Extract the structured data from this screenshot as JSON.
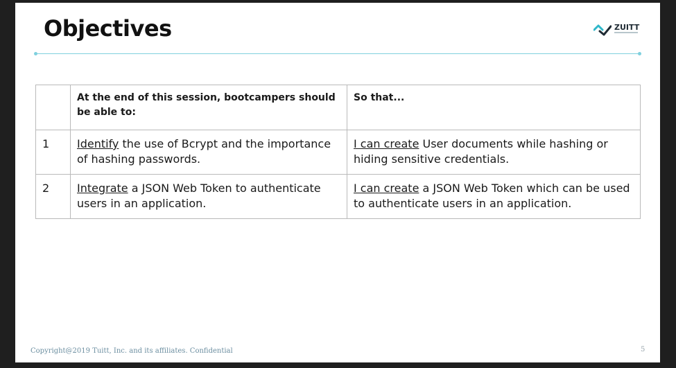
{
  "slide": {
    "title": "Objectives",
    "logo_text": "ZUITT",
    "footer": "Copyright@2019 Tuitt, Inc. and its affiliates. Confidential",
    "page_number": "5"
  },
  "table": {
    "headers": [
      "",
      "At the end of this session, bootcampers should be able to:",
      "So that..."
    ],
    "rows": [
      {
        "num": "1",
        "objective_verb": "Identify",
        "objective_rest": " the use of Bcrypt and the importance of hashing passwords.",
        "outcome_lead": "I can create",
        "outcome_rest": " User documents while hashing or hiding sensitive credentials."
      },
      {
        "num": "2",
        "objective_verb": "Integrate",
        "objective_rest": " a JSON Web Token to authenticate users in an application.",
        "outcome_lead": "I can create",
        "outcome_rest": " a JSON Web Token which can be used to authenticate users in an application."
      }
    ]
  },
  "colors": {
    "accent_rule": "#7fd0de",
    "logo_mark": "#2fb7c9",
    "frame": "#1f1f1f"
  }
}
